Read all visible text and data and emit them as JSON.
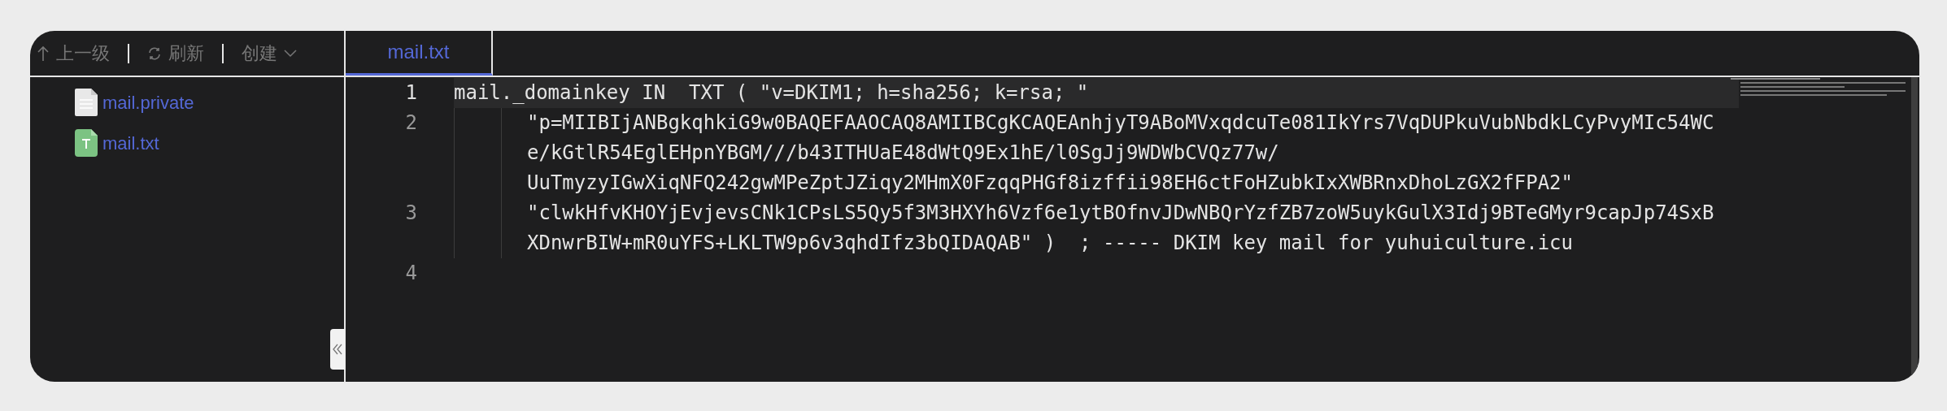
{
  "toolbar": {
    "items": [
      {
        "kind": "up",
        "label": "上一级"
      },
      {
        "kind": "refresh",
        "label": "刷新"
      },
      {
        "kind": "create",
        "label": "创建"
      }
    ]
  },
  "files": [
    {
      "kind": "file",
      "name": "mail.private"
    },
    {
      "kind": "text",
      "name": "mail.txt"
    }
  ],
  "tabs": [
    {
      "label": "mail.txt",
      "selected": true
    }
  ],
  "editor": {
    "lines": [
      {
        "number": "1",
        "kind": "statement",
        "current": true,
        "rows": [
          "mail._domainkey IN  TXT ( \"v=DKIM1; h=sha256; k=rsa; \""
        ]
      },
      {
        "number": "2",
        "kind": "continuation",
        "current": false,
        "rows": [
          "\"p=MIIBIjANBgkqhkiG9w0BAQEFAAOCAQ8AMIIBCgKCAQEAnhjyT9ABoMVxqdcuTe081IkYrs7VqDUPkuVubNbdkLCyPvyMIc54WC",
          "e/kGtlR54EglEHpnYBGM///b43ITHUaE48dWtQ9Ex1hE/l0SgJj9WDWbCVQz77w/",
          "UuTmyzyIGwXiqNFQ242gwMPeZptJZiqy2MHmX0FzqqPHGf8izffii98EH6ctFoHZubkIxXWBRnxDhoLzGX2fFPA2\""
        ]
      },
      {
        "number": "3",
        "kind": "continuation",
        "current": false,
        "rows": [
          "\"clwkHfvKHOYjEvjevsCNk1CPsLS5Qy5f3M3HXYh6Vzf6e1ytBOfnvJDwNBQrYzfZB7zoW5uykGulX3Idj9BTeGMyr9capJp74SxB",
          "XDnwrBIW+mR0uYFS+LKLTW9p6v3qhdIfz3bQIDAQAB\" )  ; ----- DKIM key mail for yuhuiculture.icu"
        ]
      },
      {
        "number": "4",
        "kind": "statement",
        "current": false
      }
    ]
  }
}
